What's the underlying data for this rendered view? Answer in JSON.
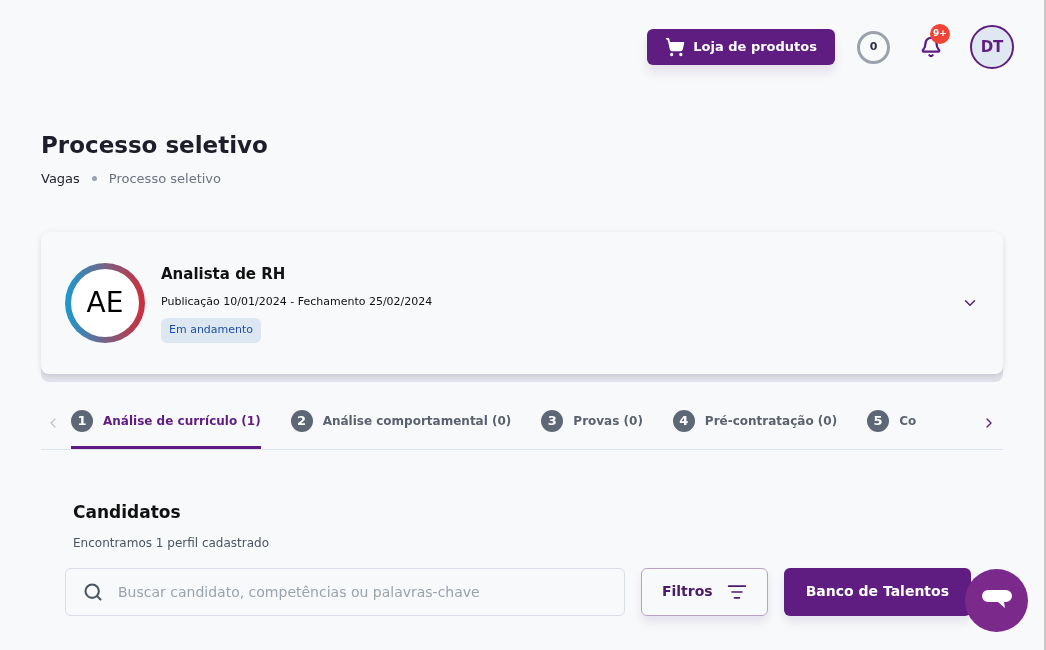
{
  "header": {
    "store_button": "Loja de produtos",
    "counter": "0",
    "notification_badge": "9+",
    "avatar": "DT"
  },
  "page": {
    "title": "Processo seletivo",
    "breadcrumb": [
      "Vagas",
      "Processo seletivo"
    ]
  },
  "job": {
    "initials": "AE",
    "title": "Analista de RH",
    "dates": "Publicação 10/01/2024 - Fechamento 25/02/2024",
    "status": "Em andamento",
    "expanded": false
  },
  "steps": [
    {
      "number": "1",
      "label": "Análise de currículo (1)",
      "selected": true
    },
    {
      "number": "2",
      "label": "Análise comportamental (0)",
      "selected": false
    },
    {
      "number": "3",
      "label": "Provas (0)",
      "selected": false
    },
    {
      "number": "4",
      "label": "Pré-contratação (0)",
      "selected": false
    },
    {
      "number": "5",
      "label": "Co",
      "selected": false
    }
  ],
  "candidates": {
    "title": "Candidatos",
    "subtitle": "Encontramos 1 perfil cadastrado",
    "search_placeholder": "Buscar candidato, competências ou palavras-chave",
    "filter_button": "Filtros",
    "talent_button": "Banco de Talentos"
  }
}
